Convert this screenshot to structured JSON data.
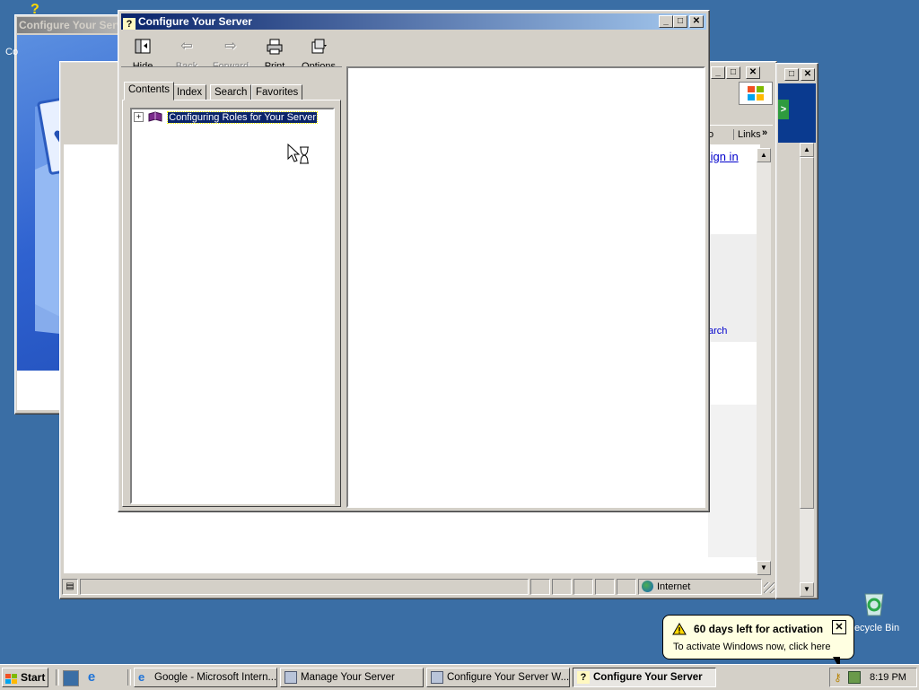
{
  "desktop": {
    "left_title_partial": "Configure Your Serv",
    "left_icon_partial": "Co",
    "recycle_bin": "Recycle Bin"
  },
  "ie_window": {
    "links_label": "Links",
    "links_partial": "o",
    "chevron": "»",
    "sign_in": "Sign in",
    "link_separator": "| ",
    "search_partial": "arch",
    "status_zone": "Internet"
  },
  "help_window": {
    "title": "Configure Your Server",
    "toolbar": {
      "hide": "Hide",
      "back": "Back",
      "forward": "Forward",
      "print": "Print",
      "options": "Options"
    },
    "tabs": [
      "Contents",
      "Index",
      "Search",
      "Favorites"
    ],
    "tree_item": "Configuring Roles for Your Server"
  },
  "balloon": {
    "title": "60 days left for activation",
    "text": "To activate Windows now, click here"
  },
  "taskbar": {
    "start": "Start",
    "buttons": [
      {
        "label": "Google - Microsoft Intern...",
        "active": false
      },
      {
        "label": "Manage Your Server",
        "active": false
      },
      {
        "label": "Configure Your Server W...",
        "active": false
      },
      {
        "label": "Configure Your Server",
        "active": true
      }
    ],
    "clock": "8:19 PM"
  },
  "colors": {
    "desktop": "#3a6ea5",
    "title_active": "#0a246a",
    "title_active_end": "#a6caf0",
    "face": "#d4d0c8",
    "selection": "#0a246a"
  }
}
